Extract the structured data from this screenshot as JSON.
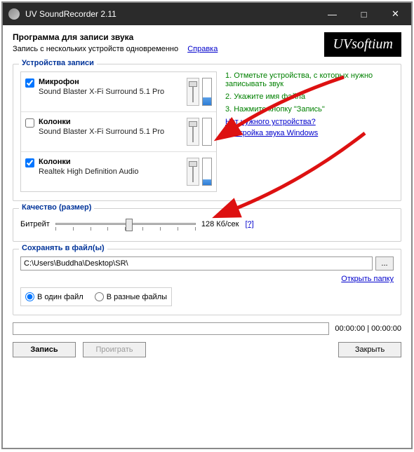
{
  "window": {
    "title": "UV SoundRecorder 2.11",
    "minimize": "—",
    "maximize": "□",
    "close": "✕"
  },
  "header": {
    "title": "Программа для записи звука",
    "subtitle": "Запись с нескольких устройств одновременно",
    "help_link": "Справка",
    "logo": "UVsoftium"
  },
  "devices": {
    "group_title": "Устройства записи",
    "items": [
      {
        "checked": true,
        "name": "Микрофон",
        "desc": "Sound Blaster X-Fi Surround 5.1 Pro",
        "level": 30
      },
      {
        "checked": false,
        "name": "Колонки",
        "desc": "Sound Blaster X-Fi Surround 5.1 Pro",
        "level": 0
      },
      {
        "checked": true,
        "name": "Колонки",
        "desc": "Realtek High Definition Audio",
        "level": 20
      }
    ],
    "hints": {
      "step1": "1. Отметьте устройства, с которых нужно записывать звук",
      "step2": "2. Укажите имя файла",
      "step3": "3. Нажмите кнопку \"Запись\"",
      "link1": "Нет нужного устройства?",
      "link2": "Настройка звука Windows"
    }
  },
  "quality": {
    "group_title": "Качество (размер)",
    "label": "Битрейт",
    "value": "128 Кб/сек",
    "help": "[?]"
  },
  "save": {
    "group_title": "Сохранять в файл(ы)",
    "path": "C:\\Users\\Buddha\\Desktop\\SR\\",
    "browse": "...",
    "open_folder": "Открыть папку",
    "radio1": "В один файл",
    "radio2": "В разные файлы"
  },
  "progress": {
    "time": "00:00:00 | 00:00:00"
  },
  "buttons": {
    "record": "Запись",
    "play": "Проиграть",
    "close": "Закрыть"
  }
}
